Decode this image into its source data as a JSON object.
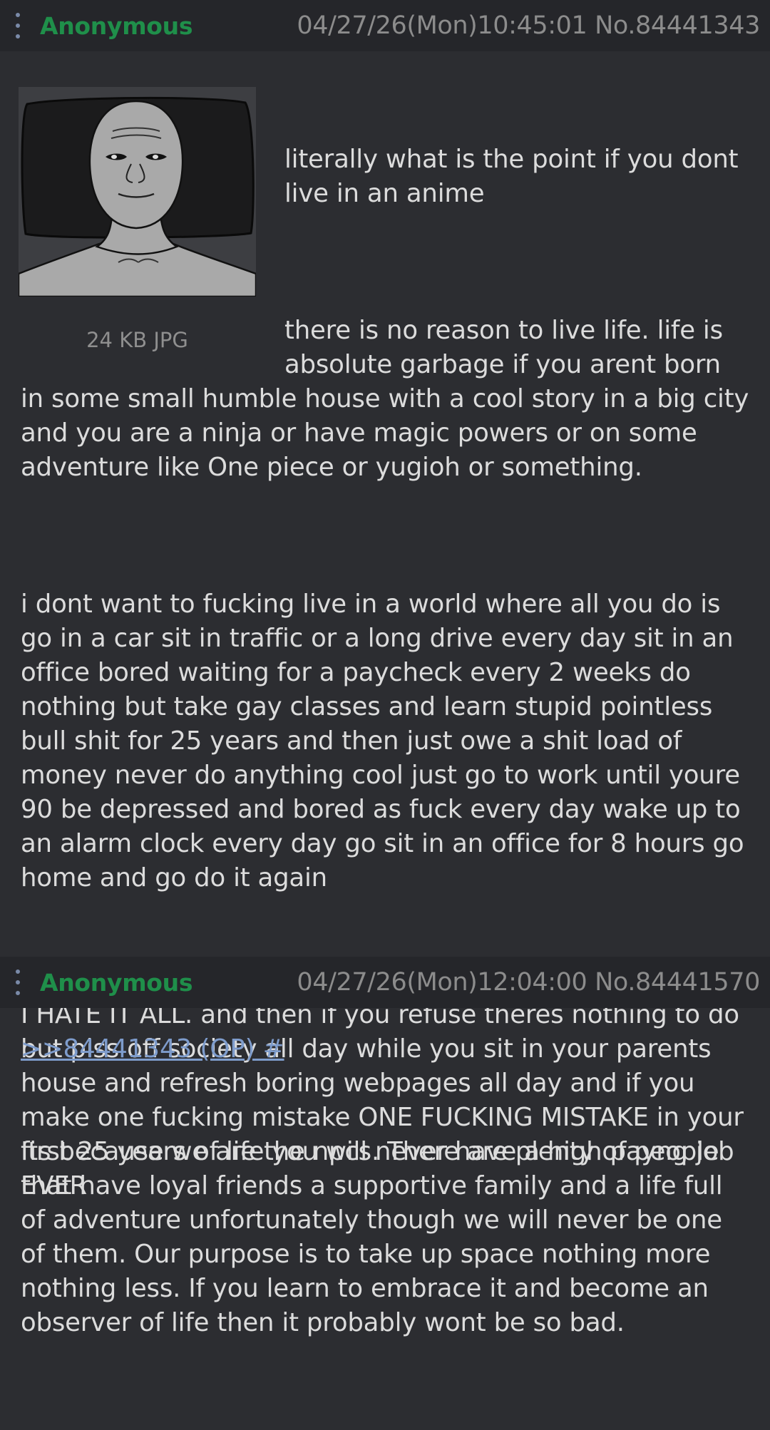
{
  "posts": [
    {
      "name": "Anonymous",
      "meta": "04/27/26(Mon)10:45:01 No.84441343",
      "file_info": "24 KB JPG",
      "paragraphs": [
        "literally what is the point if you dont live in an anime",
        "there is no reason to live life. life is absolute garbage if you arent born in some small humble house with a cool story in a big city and you are a ninja or have magic powers or on some adventure like One piece or yugioh or something.",
        "i dont want to fucking live in a world where all you do is go in a car sit in traffic or a long drive every day sit in an office bored waiting for a paycheck every 2 weeks do nothing but take gay classes and learn stupid pointless bull shit for 25 years and then just owe a shit load of money never do anything cool just go to work until youre 90 be depressed and bored as fuck every day wake up to an alarm clock every day go sit in an office for 8 hours go home and go do it again",
        "I HATE IT ALL. and then if you refuse theres nothing to do but piss off society all day while you sit in your parents house and refresh boring webpages all day and if you make one fucking mistake ONE FUCKING MISTAKE in your first 25 years of life you will never have a high payng job EVER"
      ]
    },
    {
      "name": "Anonymous",
      "meta": "04/27/26(Mon)12:04:00 No.84441570",
      "reply_link": ">>84441343 (OP) #",
      "paragraphs": [
        "Its because we are the npcs. There are plenty of people that have loyal friends a supportive family and a life full of adventure unfortunately though we will never be one of them. Our purpose is to take up space nothing more nothing less. If you learn to embrace it and become an observer of life then it probably wont be so bad."
      ]
    }
  ],
  "colors": {
    "name": "#1f8f4a",
    "meta": "#8c8c8c",
    "link": "#7e9ccc",
    "header_bg": "#25262a",
    "body_bg": "#2c2d31"
  },
  "icons": {
    "menu": "kebab-menu-icon",
    "thumbnail": "wojak-face-thumbnail"
  }
}
